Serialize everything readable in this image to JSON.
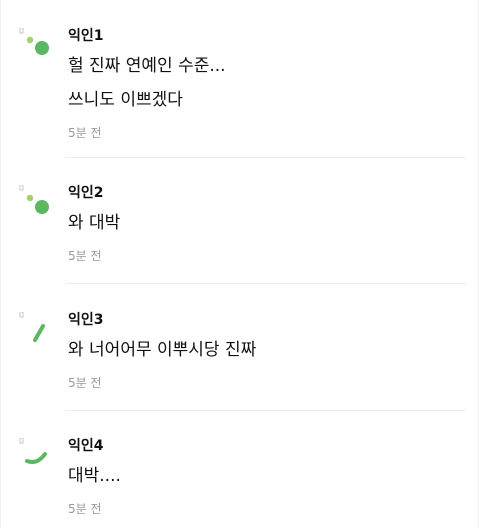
{
  "colors": {
    "avatar_green": "#5cb860",
    "avatar_light_green": "#9fd36a",
    "avatar_marker": "#c8c8c8",
    "time_gray": "#9a9a9a",
    "divider": "#ededed"
  },
  "comments": [
    {
      "author": "익인1",
      "lines": [
        "헐 진짜 연예인 수준...",
        "쓰니도 이쁘겠다"
      ],
      "time": "5분 전",
      "avatar": "dots-icon"
    },
    {
      "author": "익인2",
      "lines": [
        "와 대박"
      ],
      "time": "5분 전",
      "avatar": "dots-icon"
    },
    {
      "author": "익인3",
      "lines": [
        "와 너어어무 이뿌시당 진짜"
      ],
      "time": "5분 전",
      "avatar": "stroke-icon"
    },
    {
      "author": "익인4",
      "lines": [
        "대박...."
      ],
      "time": "5분 전",
      "avatar": "curve-icon"
    }
  ]
}
